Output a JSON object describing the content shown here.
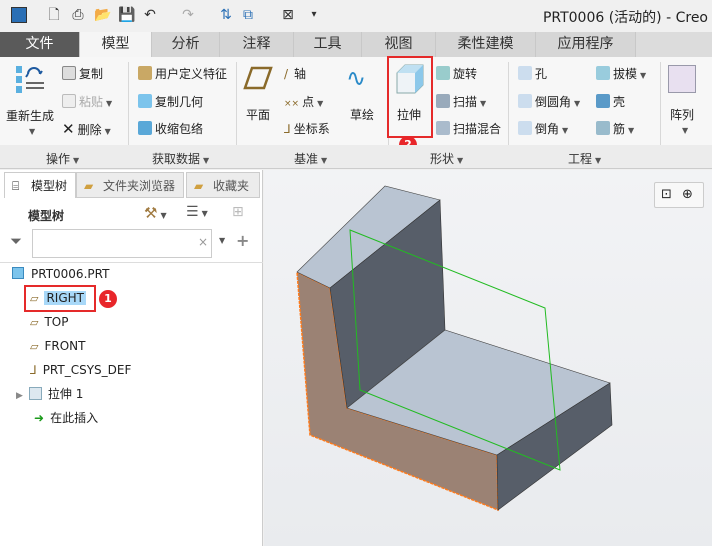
{
  "window": {
    "title": "PRT0006 (活动的) - Creo"
  },
  "quick_access": [
    "app-icon",
    "new-icon",
    "print-icon",
    "open-icon",
    "save-icon",
    "undo-icon",
    "redo-icon",
    "regenerate-icon",
    "windows-icon",
    "close-icon",
    "customize-icon"
  ],
  "tabs": [
    {
      "label": "文件"
    },
    {
      "label": "模型",
      "active": true
    },
    {
      "label": "分析"
    },
    {
      "label": "注释"
    },
    {
      "label": "工具"
    },
    {
      "label": "视图"
    },
    {
      "label": "柔性建模"
    },
    {
      "label": "应用程序"
    }
  ],
  "ribbon": {
    "operations": {
      "label": "操作",
      "regenerate": "重新生成",
      "copy": "复制",
      "paste": "粘贴",
      "delete": "删除"
    },
    "get_data": {
      "label": "获取数据",
      "udf": "用户定义特征",
      "copy_geom": "复制几何",
      "shrinkwrap": "收缩包络"
    },
    "datum": {
      "label": "基准",
      "plane": "平面",
      "axis": "轴",
      "point": "点",
      "csys": "坐标系",
      "sketch": "草绘"
    },
    "shape": {
      "label": "形状",
      "extrude": "拉伸",
      "revolve": "旋转",
      "sweep": "扫描",
      "swept_blend": "扫描混合"
    },
    "engineering": {
      "label": "工程",
      "hole": "孔",
      "round": "倒圆角",
      "chamfer": "倒角",
      "draft": "拔模",
      "shell": "壳",
      "rib": "筋"
    },
    "pattern": {
      "label": "阵列"
    }
  },
  "panel": {
    "tabs": [
      "模型树",
      "文件夹浏览器",
      "收藏夹"
    ],
    "header": "模型树",
    "search_placeholder": "",
    "tree": [
      {
        "label": "PRT0006.PRT",
        "icon": "part-icon"
      },
      {
        "label": "RIGHT",
        "icon": "plane-icon",
        "selected": true
      },
      {
        "label": "TOP",
        "icon": "plane-icon"
      },
      {
        "label": "FRONT",
        "icon": "plane-icon"
      },
      {
        "label": "PRT_CSYS_DEF",
        "icon": "csys-icon"
      },
      {
        "label": "拉伸 1",
        "icon": "extrude-icon"
      },
      {
        "label": "在此插入",
        "icon": "insert-arrow-icon"
      }
    ]
  },
  "callouts": [
    "1",
    "2"
  ],
  "colors": {
    "highlight": "#e52a2a",
    "selection": "#a8d8f8",
    "model_top": "#b9c4d2",
    "model_side": "#575e69",
    "model_front": "#9b8274",
    "datum_plane": "#22bb22"
  }
}
